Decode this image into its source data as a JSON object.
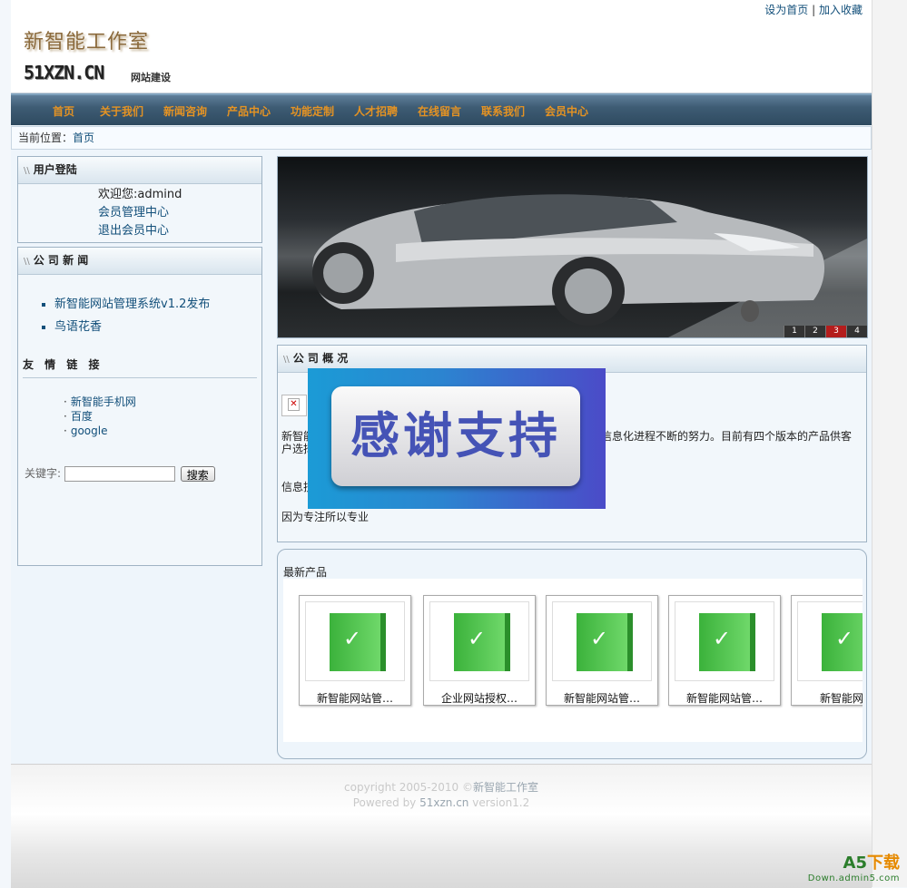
{
  "header": {
    "toplinks": {
      "home": "设为首页",
      "sep": "|",
      "favorite": "加入收藏"
    },
    "logo_cn": "新智能工作室",
    "logo_en": "51XZN.CN",
    "logo_sub": "网站建设"
  },
  "nav": {
    "items": [
      "首页",
      "关于我们",
      "新闻咨询",
      "产品中心",
      "功能定制",
      "人才招聘",
      "在线留言",
      "联系我们",
      "会员中心"
    ]
  },
  "breadcrumb": {
    "label": "当前位置：",
    "current": "首页"
  },
  "login": {
    "title": "用户登陆",
    "welcome": "欢迎您:admind",
    "member_center": "会员管理中心",
    "logout": "退出会员中心"
  },
  "news": {
    "title": "公 司 新 闻",
    "items": [
      "新智能网站管理系统v1.2发布",
      "鸟语花香"
    ]
  },
  "friend_links": {
    "title": "友 情 链 接",
    "items": [
      "新智能手机网",
      "百度",
      "google"
    ]
  },
  "search": {
    "label": "关键字:",
    "value": "",
    "button": "搜索"
  },
  "banner": {
    "pages": [
      "1",
      "2",
      "3",
      "4"
    ],
    "active_page": "3"
  },
  "about": {
    "title": "公 司 概 况",
    "para1_start": "新智能",
    "para1_end": "信息化进程不断的努力。目前有四个版本的产品供客",
    "para1_line2": "户选择",
    "para2": "信息技",
    "para3": "因为专注所以专业"
  },
  "overlay": {
    "text": "感谢支持"
  },
  "products": {
    "title": "最新产品",
    "items": [
      "新智能网站管…",
      "企业网站授权…",
      "新智能网站管…",
      "新智能网站管…",
      "新智能网站"
    ]
  },
  "footer": {
    "line1_prefix": "copyright 2005-2010 ©",
    "line1_name": "新智能工作室",
    "line2_prefix": "Powered by ",
    "line2_site": "51xzn.cn",
    "line2_version": " version1.2"
  },
  "watermark": {
    "a5": "A5",
    "download": "下载",
    "site": "Down.admin5.com"
  }
}
